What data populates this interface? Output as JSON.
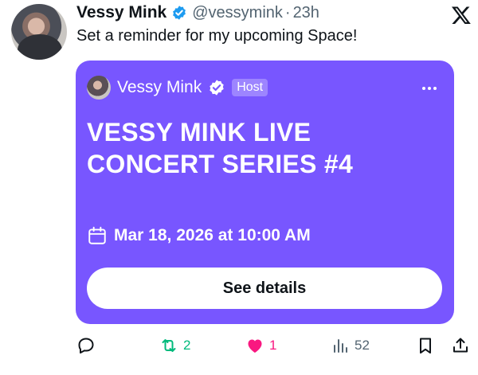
{
  "tweet": {
    "author_name": "Vessy Mink",
    "handle": "@vessymink",
    "separator": "·",
    "time": "23h",
    "text": "Set a reminder for my upcoming Space!"
  },
  "space_card": {
    "host_name": "Vessy Mink",
    "host_tag": "Host",
    "title_line1": "VESSY MINK LIVE",
    "title_line2": "CONCERT SERIES #4",
    "date": "Mar 18, 2026 at 10:00 AM",
    "button_label": "See details",
    "background_color": "#7856ff"
  },
  "actions": {
    "retweets": "2",
    "likes": "1",
    "views": "52",
    "retweet_color": "#00ba7c",
    "like_color": "#f91880"
  },
  "icons": [
    "verified-badge-icon",
    "x-logo-icon",
    "more-icon",
    "calendar-icon",
    "reply-icon",
    "retweet-icon",
    "heart-icon",
    "views-icon",
    "bookmark-icon",
    "share-icon"
  ]
}
